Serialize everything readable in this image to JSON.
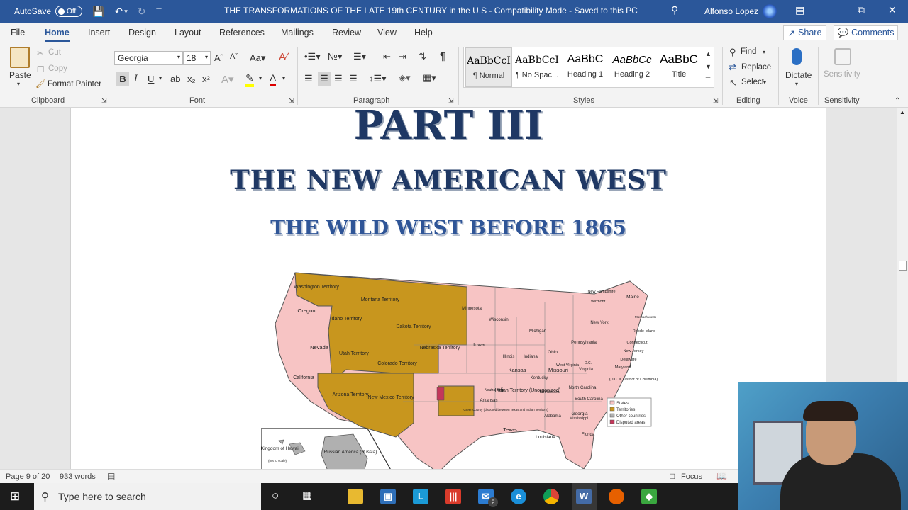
{
  "titlebar": {
    "autosave_label": "AutoSave",
    "autosave_state": "Off",
    "document_title": "THE TRANSFORMATIONS OF THE LATE 19th CENTURY in the U.S  -  Compatibility Mode  -  Saved to this PC",
    "user_name": "Alfonso Lopez"
  },
  "tabs": [
    "File",
    "Home",
    "Insert",
    "Design",
    "Layout",
    "References",
    "Mailings",
    "Review",
    "View",
    "Help"
  ],
  "share_label": "Share",
  "comments_label": "Comments",
  "ribbon": {
    "clipboard": {
      "paste": "Paste",
      "cut": "Cut",
      "copy": "Copy",
      "format_painter": "Format Painter",
      "label": "Clipboard"
    },
    "font": {
      "name": "Georgia",
      "size": "18",
      "label": "Font",
      "bold": "B",
      "italic": "I",
      "underline": "U",
      "strike": "ab",
      "subscript": "x₂",
      "superscript": "x²"
    },
    "paragraph": {
      "label": "Paragraph"
    },
    "styles": {
      "label": "Styles",
      "items": [
        {
          "preview": "AaBbCcI",
          "name": "¶ Normal"
        },
        {
          "preview": "AaBbCcI",
          "name": "¶ No Spac..."
        },
        {
          "preview": "AaBbC",
          "name": "Heading 1"
        },
        {
          "preview": "AaBbCc",
          "name": "Heading 2"
        },
        {
          "preview": "AaBbC",
          "name": "Title"
        }
      ]
    },
    "editing": {
      "find": "Find",
      "replace": "Replace",
      "select": "Select",
      "label": "Editing"
    },
    "voice": {
      "dictate": "Dictate",
      "label": "Voice"
    },
    "sensitivity": {
      "button": "Sensitivity",
      "label": "Sensitivity"
    }
  },
  "document": {
    "heading_part": "PART III",
    "heading_main": "THE NEW AMERICAN WEST",
    "heading_sub": "THE WILD WEST BEFORE 1865",
    "map": {
      "labels": [
        "Washington Territory",
        "Oregon",
        "Idaho Territory",
        "Montana Territory",
        "Dakota Territory",
        "Minnesota",
        "Wisconsin",
        "Michigan",
        "Nevada",
        "California",
        "Utah Territory",
        "Colorado Territory",
        "Nebraska Territory",
        "Iowa",
        "Illinois",
        "Indiana",
        "Ohio",
        "Pennsylvania",
        "New York",
        "Maine",
        "New Hampshire",
        "Vermont",
        "Massachusetts",
        "Rhode Island",
        "Connecticut",
        "New Jersey",
        "Delaware",
        "Maryland",
        "(D.C. = District of Columbia)",
        "Kansas",
        "Missouri",
        "Kentucky",
        "West Virginia",
        "Virginia",
        "D.C.",
        "North Carolina",
        "Tennessee",
        "South Carolina",
        "Arkansas",
        "Arizona Territory",
        "New Mexico Territory",
        "Neutral Strip",
        "Indian Territory (Unorganized)",
        "Greer County (disputed between Texas and Indian Territory)",
        "Texas",
        "Louisiana",
        "Mississippi",
        "Alabama",
        "Georgia",
        "Florida",
        "Kingdom of Hawaii",
        "(not to scale)",
        "Russian America (Russia)"
      ],
      "legend": [
        "States",
        "Territories",
        "Other countries",
        "Disputed areas"
      ],
      "colors": {
        "states": "#f7c4c4",
        "territories": "#c8961e",
        "other": "#b0b0b0",
        "disputed": "#c4365a"
      }
    }
  },
  "statusbar": {
    "page": "Page 9 of 20",
    "words": "933 words",
    "focus": "Focus"
  },
  "taskbar": {
    "search_placeholder": "Type here to search",
    "mail_badge": "2"
  }
}
